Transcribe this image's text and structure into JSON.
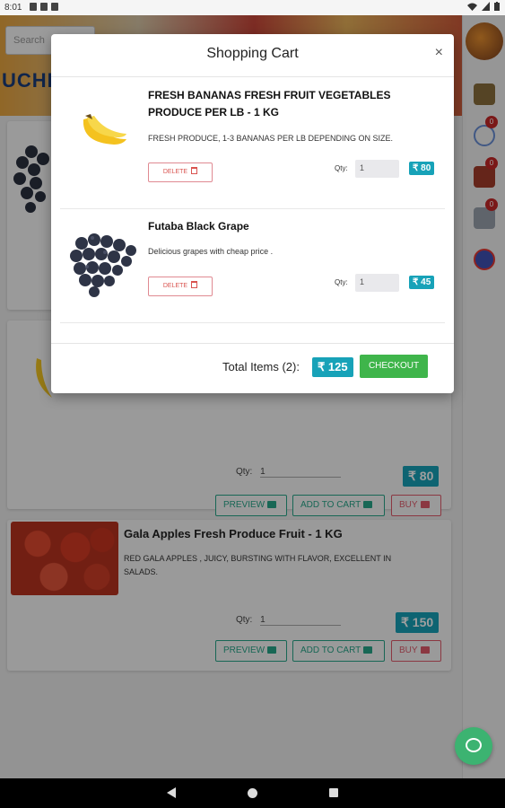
{
  "status_bar": {
    "time": "8:01"
  },
  "background": {
    "search_placeholder": "Search",
    "logo_text": "UCHI",
    "products": [
      {
        "title": "",
        "qty_label": "Qty:",
        "qty_value": "1",
        "price": "₹ 80",
        "preview_label": "PREVIEW",
        "add_label": "ADD TO CART",
        "buy_label": "BUY"
      },
      {
        "title": "Gala Apples Fresh Produce Fruit - 1 KG",
        "description": "RED GALA APPLES , JUICY, BURSTING WITH FLAVOR, EXCELLENT IN SALADS.",
        "qty_label": "Qty:",
        "qty_value": "1",
        "price": "₹ 150",
        "preview_label": "PREVIEW",
        "add_label": "ADD TO CART",
        "buy_label": "BUY"
      }
    ]
  },
  "rail": {
    "badges": [
      "0",
      "0",
      "0"
    ]
  },
  "cart": {
    "title": "Shopping Cart",
    "close_label": "×",
    "items": [
      {
        "name": "FRESH BANANAS FRESH FRUIT VEGETABLES PRODUCE PER LB - 1 KG",
        "description": "FRESH PRODUCE, 1-3 BANANAS PER LB DEPENDING ON SIZE.",
        "delete_label": "DELETE",
        "qty_label": "Qty:",
        "qty_value": "1",
        "price": "₹ 80"
      },
      {
        "name": "Futaba Black Grape",
        "description": "Delicious grapes with cheap price .",
        "delete_label": "DELETE",
        "qty_label": "Qty:",
        "qty_value": "1",
        "price": "₹ 45"
      }
    ],
    "total_label": "Total Items (2):",
    "total_price": "₹ 125",
    "checkout_label": "CHECKOUT"
  }
}
